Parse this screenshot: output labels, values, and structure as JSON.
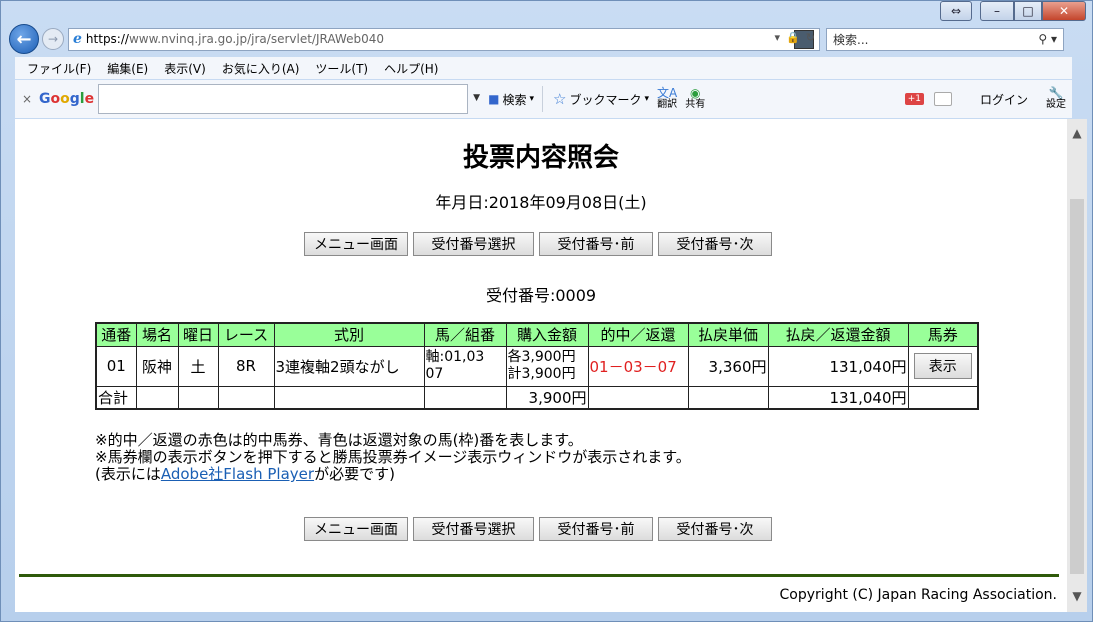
{
  "browser": {
    "url_scheme": "https://",
    "url_rest": "www.nvinq.jra.go.jp/jra/servlet/JRAWeb040",
    "search_placeholder": "検索...",
    "menu": [
      "ファイル(F)",
      "編集(E)",
      "表示(V)",
      "お気に入り(A)",
      "ツール(T)",
      "ヘルプ(H)"
    ],
    "toolbar": {
      "google_x": "×",
      "search_label": "検索",
      "bookmark_label": "ブックマーク",
      "translate_label": "翻訳",
      "share_label": "共有",
      "plus_label": "+1",
      "login_label": "ログイン",
      "settings_label": "設定"
    }
  },
  "page": {
    "title": "投票内容照会",
    "date": "年月日:2018年09月08日(土)",
    "buttons": {
      "menu": "メニュー画面",
      "select": "受付番号選択",
      "prev": "受付番号･前",
      "next": "受付番号･次"
    },
    "receipt": "受付番号:0009",
    "table": {
      "headers": [
        "通番",
        "場名",
        "曜日",
        "レース",
        "式別",
        "馬／組番",
        "購入金額",
        "的中／返還",
        "払戻単価",
        "払戻／返還金額",
        "馬券"
      ],
      "row": {
        "no": "01",
        "venue": "阪神",
        "day": "土",
        "race": "8R",
        "type": "3連複軸2頭ながし",
        "combo_line1": "軸:01,03",
        "combo_line2": "07",
        "amount_line1": "各3,900円",
        "amount_line2": "計3,900円",
        "hit": "01－03－07",
        "unit_price": "3,360円",
        "payout": "131,040円",
        "show_button": "表示"
      },
      "total": {
        "label": "合計",
        "amount": "3,900円",
        "payout": "131,040円"
      }
    },
    "notes": {
      "line1": "※的中／返還の赤色は的中馬券、青色は返還対象の馬(枠)番を表します。",
      "line2": "※馬券欄の表示ボタンを押下すると勝馬投票券イメージ表示ウィンドウが表示されます。",
      "line3_prefix": "(表示には",
      "line3_link": "Adobe社Flash Player",
      "line3_suffix": "が必要です)"
    },
    "copyright": "Copyright (C) Japan Racing Association."
  }
}
